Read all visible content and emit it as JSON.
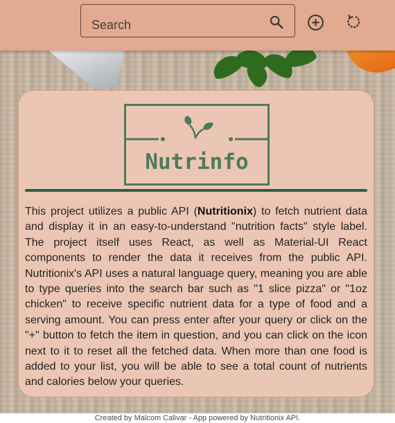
{
  "header": {
    "search": {
      "placeholder": "Search",
      "value": ""
    },
    "icons": {
      "search": "search-icon",
      "add": "add-circle-icon",
      "reset": "refresh-icon"
    }
  },
  "card": {
    "logo": {
      "text": "Nutrinfo",
      "icon": "sprout-icon"
    },
    "description": {
      "part1": "This project utilizes a public API (",
      "api_name": "Nutritionix",
      "part2": ") to fetch nutrient data and display it in an easy-to-understand \"nutrition facts\" style label. The project itself uses React, as well as Material-UI React components to render the data it receives from the public API. Nutritionix's API uses a natural language query, meaning you are able to type queries into the search bar such as \"1 slice pizza\" or \"1oz chicken\" to receive specific nutrient data for a type of food and a serving amount. You can press enter after your query or click on the \"+\" button to fetch the item in question, and you can click on the icon next to it to reset all the fetched data. When more than one food is added to your list, you will be able to see a total count of nutrients and calories below your queries."
    }
  },
  "footer": {
    "text": "Created by Malcom Calivar - App powered by Nutritionix API."
  },
  "colors": {
    "header_bg": "#e2aa90",
    "card_bg": "#ecc6b4",
    "brand_green": "#4e7a5c",
    "divider": "#2d5e47"
  }
}
